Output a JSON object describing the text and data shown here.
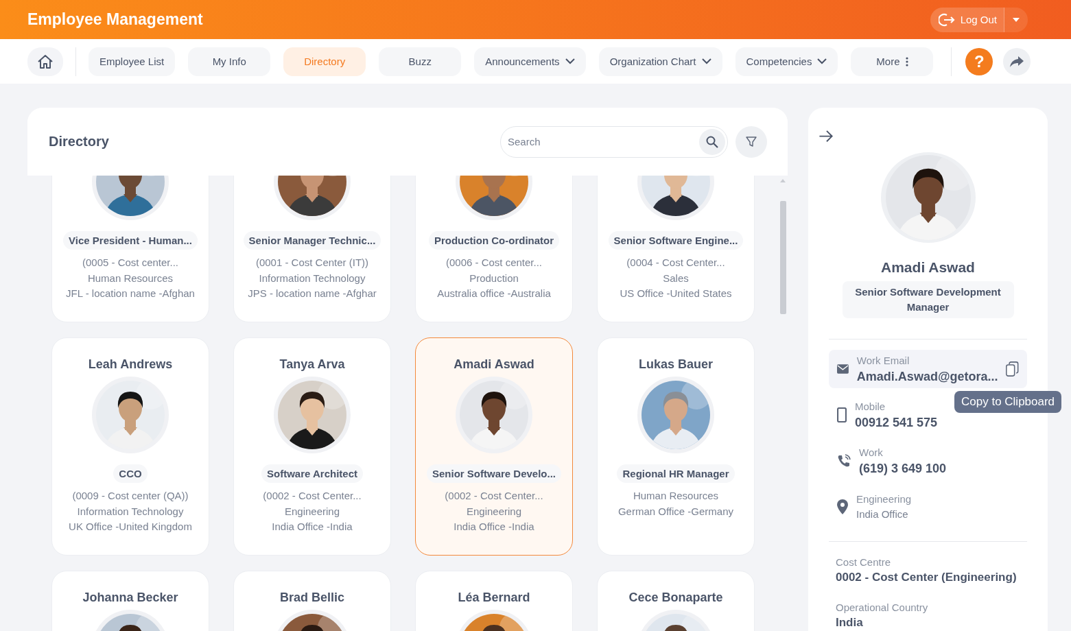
{
  "header": {
    "title": "Employee Management",
    "logout": "Log Out"
  },
  "nav": [
    {
      "label": "Employee List",
      "kind": "tab",
      "selected": false
    },
    {
      "label": "My Info",
      "kind": "tab",
      "selected": false
    },
    {
      "label": "Directory",
      "kind": "tab",
      "selected": true
    },
    {
      "label": "Buzz",
      "kind": "tab",
      "selected": false
    },
    {
      "label": "Announcements",
      "kind": "dropdown",
      "selected": false
    },
    {
      "label": "Organization Chart",
      "kind": "dropdown",
      "selected": false
    },
    {
      "label": "Competencies",
      "kind": "dropdown",
      "selected": false
    },
    {
      "label": "More",
      "kind": "more",
      "selected": false
    }
  ],
  "help": "?",
  "directory": {
    "title": "Directory",
    "search": {
      "placeholder": "Search"
    },
    "cards": [
      {
        "title": "Vice President - Human...",
        "lines": [
          "(0005 - Cost center...",
          "Human Resources",
          "JFL - location name -Afghan"
        ],
        "selected": false
      },
      {
        "title": "Senior Manager Technic...",
        "lines": [
          "(0001 - Cost Center (IT))",
          "Information Technology",
          "JPS - location name -Afghar"
        ],
        "selected": false
      },
      {
        "title": "Production Co-ordinator",
        "lines": [
          "(0006 - Cost center...",
          "Production",
          "Australia office -Australia"
        ],
        "selected": false
      },
      {
        "title": "Senior Software Engine...",
        "lines": [
          "(0004 - Cost Center...",
          "Sales",
          "US Office -United States"
        ],
        "selected": false
      },
      {
        "name": "Leah Andrews",
        "title": "CCO",
        "lines": [
          "(0009 - Cost center (QA))",
          "Information Technology",
          "UK Office -United Kingdom"
        ],
        "selected": false
      },
      {
        "name": "Tanya Arva",
        "title": "Software Architect",
        "lines": [
          "(0002 - Cost Center...",
          "Engineering",
          "India Office -India"
        ],
        "selected": false
      },
      {
        "name": "Amadi Aswad",
        "title": "Senior Software Develo...",
        "lines": [
          "(0002 - Cost Center...",
          "Engineering",
          "India Office -India"
        ],
        "selected": true
      },
      {
        "name": "Lukas Bauer",
        "title": "Regional HR Manager",
        "lines": [
          "Human Resources",
          "German Office -Germany"
        ],
        "selected": false
      },
      {
        "name": "Johanna Becker",
        "selected": false
      },
      {
        "name": "Brad Bellic",
        "selected": false
      },
      {
        "name": "Léa Bernard",
        "selected": false
      },
      {
        "name": "Cece Bonaparte",
        "selected": false
      }
    ]
  },
  "profile": {
    "name": "Amadi Aswad",
    "title": "Senior Software Development Manager",
    "contacts": [
      {
        "kind": "email",
        "label": "Work Email",
        "value": "Amadi.Aswad@getora...",
        "hovered": true
      },
      {
        "kind": "mobile",
        "label": "Mobile",
        "value": "00912 541 575",
        "hovered": false
      },
      {
        "kind": "work",
        "label": "Work",
        "value": "(619) 3 649 100",
        "hovered": false
      },
      {
        "kind": "location",
        "label": "Engineering",
        "value": "India Office",
        "hovered": false
      }
    ],
    "tooltip": "Copy to Clipboard",
    "fields": [
      {
        "label": "Cost Centre",
        "value": "0002 - Cost Center (Engineering)"
      },
      {
        "label": "Operational Country",
        "value": "India"
      }
    ]
  }
}
